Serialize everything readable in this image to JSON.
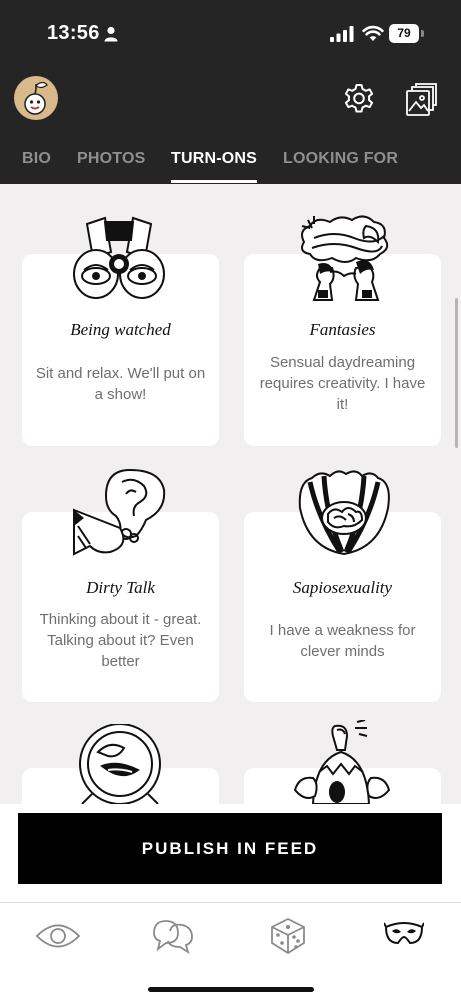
{
  "status_bar": {
    "time": "13:56",
    "battery": "79",
    "icons": [
      "person-icon",
      "signal-icon",
      "wifi-icon",
      "battery-icon"
    ]
  },
  "header": {
    "avatar": "cherry-avatar",
    "icons": [
      "gear-icon",
      "gallery-icon"
    ]
  },
  "tabs": [
    {
      "label": "BIO",
      "active": false
    },
    {
      "label": "PHOTOS",
      "active": false
    },
    {
      "label": "TURN-ONS",
      "active": true
    },
    {
      "label": "LOOKING FOR",
      "active": false
    }
  ],
  "cards": [
    {
      "title": "Being watched",
      "description": "Sit and relax. We'll put on a show!",
      "icon": "binoculars-illustration"
    },
    {
      "title": "Fantasies",
      "description": "Sensual daydreaming requires creativity. I have it!",
      "icon": "dreaming-couple-illustration"
    },
    {
      "title": "Dirty Talk",
      "description": "Thinking about it - great. Talking about it? Even better",
      "icon": "ear-illustration"
    },
    {
      "title": "Sapiosexuality",
      "description": "I have a weakness for clever minds",
      "icon": "brain-shell-illustration"
    },
    {
      "title": "",
      "description": "",
      "icon": "mouth-mirror-illustration"
    },
    {
      "title": "",
      "description": "",
      "icon": "egg-figure-illustration"
    }
  ],
  "publish": {
    "label": "PUBLISH IN FEED"
  },
  "bottom_nav": [
    {
      "icon": "eye-icon",
      "active": false
    },
    {
      "icon": "chat-bubbles-icon",
      "active": false
    },
    {
      "icon": "dice-icon",
      "active": false
    },
    {
      "icon": "mask-icon",
      "active": true
    }
  ],
  "colors": {
    "header_bg": "#252525",
    "content_bg": "#f1efef",
    "card_bg": "#ffffff",
    "button_bg": "#000000",
    "tab_inactive": "#8f8f8f"
  }
}
